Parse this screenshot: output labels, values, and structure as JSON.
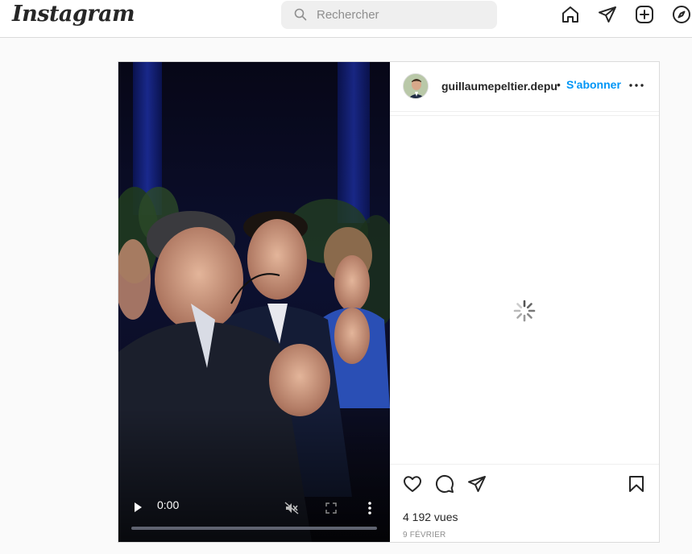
{
  "app": {
    "logo_text": "Instagram"
  },
  "search": {
    "placeholder": "Rechercher"
  },
  "nav": {
    "icons": [
      "home-icon",
      "direct-message-icon",
      "new-post-icon",
      "explore-icon"
    ]
  },
  "post": {
    "username": "guillaumepeltier.depu",
    "separator": "•",
    "follow_label": "S'abonner",
    "views": "4 192 vues",
    "date": "9 FÉVRIER",
    "video": {
      "time": "0:00"
    }
  },
  "colors": {
    "accent": "#0095f6",
    "text": "#262626",
    "muted": "#8e8e8e",
    "border": "#dbdbdb",
    "background": "#fafafa"
  }
}
